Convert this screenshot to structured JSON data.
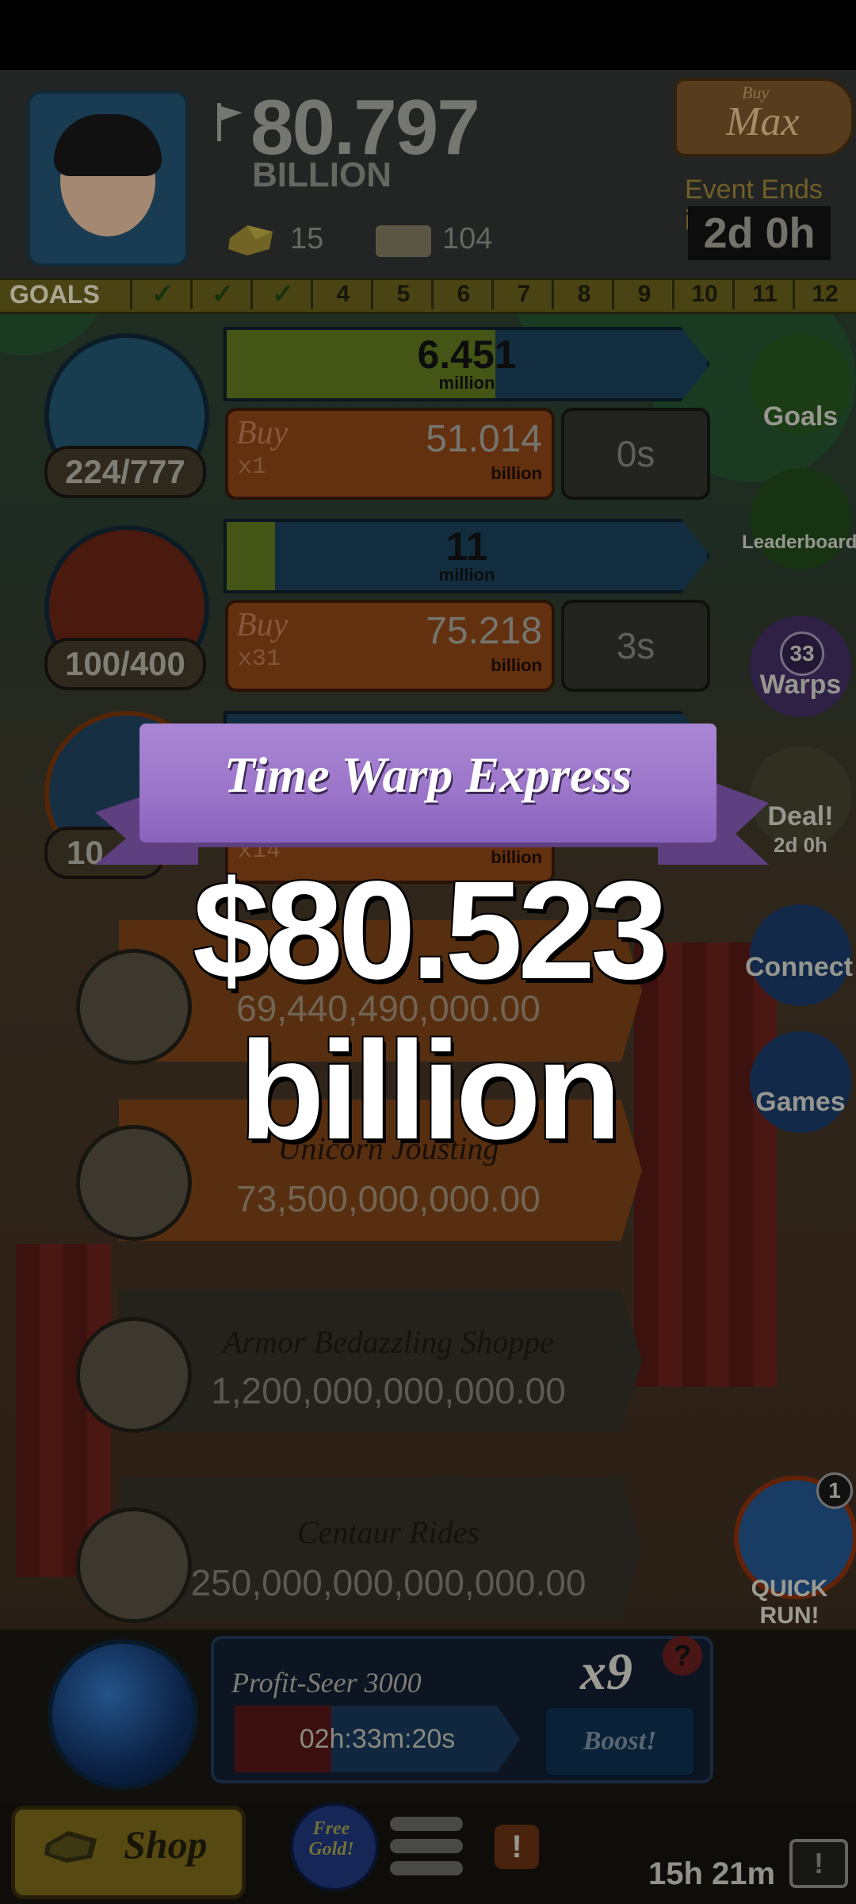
{
  "header": {
    "money": "80.797",
    "money_unit": "BILLION",
    "gold": "15",
    "tickets": "104",
    "buy_max_small": "Buy",
    "buy_max_big": "Max",
    "event_label": "Event Ends in:",
    "event_time": "2d 0h"
  },
  "goals": {
    "label": "GOALS",
    "cells": [
      "✓",
      "✓",
      "✓",
      "4",
      "5",
      "6",
      "7",
      "8",
      "9",
      "10",
      "11",
      "12"
    ]
  },
  "businesses": [
    {
      "count": "224/777",
      "progress_value": "6.451",
      "progress_unit": "million",
      "buy_word": "Buy",
      "buy_mult": "x1",
      "cost": "51.014",
      "cost_unit": "billion",
      "timer": "0s",
      "progress_fraction": 0.56
    },
    {
      "count": "100/400",
      "progress_value": "11",
      "progress_unit": "million",
      "buy_word": "Buy",
      "buy_mult": "x31",
      "cost": "75.218",
      "cost_unit": "billion",
      "timer": "3s",
      "progress_fraction": 0.1
    },
    {
      "count": "10",
      "buy_mult": "x14",
      "cost_unit": "billion"
    }
  ],
  "managers": [
    {
      "cost": "69,440,490,000.00"
    },
    {
      "name": "Unicorn Jousting",
      "cost": "73,500,000,000.00"
    },
    {
      "name": "Armor Bedazzling Shoppe",
      "cost": "1,200,000,000,000.00"
    },
    {
      "name": "Centaur Rides",
      "cost": "250,000,000,000,000.00"
    }
  ],
  "side_buttons": {
    "goals": "Goals",
    "leaderboard": "Leaderboard",
    "warps": "Warps",
    "warps_badge": "33",
    "deal": "Deal!",
    "deal_time": "2d 0h",
    "connect": "Connect",
    "games": "Games"
  },
  "overlay": {
    "title": "Time Warp Express",
    "amount": "$80.523 billion"
  },
  "quick_run": {
    "label": "QUICK RUN!",
    "badge": "1"
  },
  "boost": {
    "name": "Profit-Seer 3000",
    "multiplier": "x9",
    "help": "?",
    "timer": "02h:33m:20s",
    "button": "Boost!"
  },
  "bottom": {
    "shop": "Shop",
    "free_gold": "Free Gold!",
    "alert": "!",
    "timer": "15h 21m",
    "tv": "!"
  },
  "colors": {
    "ribbon": "#9c76ca",
    "overlay_text": "#ffffff",
    "progress_fill": "#53681c",
    "buy_button": "#7a3c14"
  }
}
